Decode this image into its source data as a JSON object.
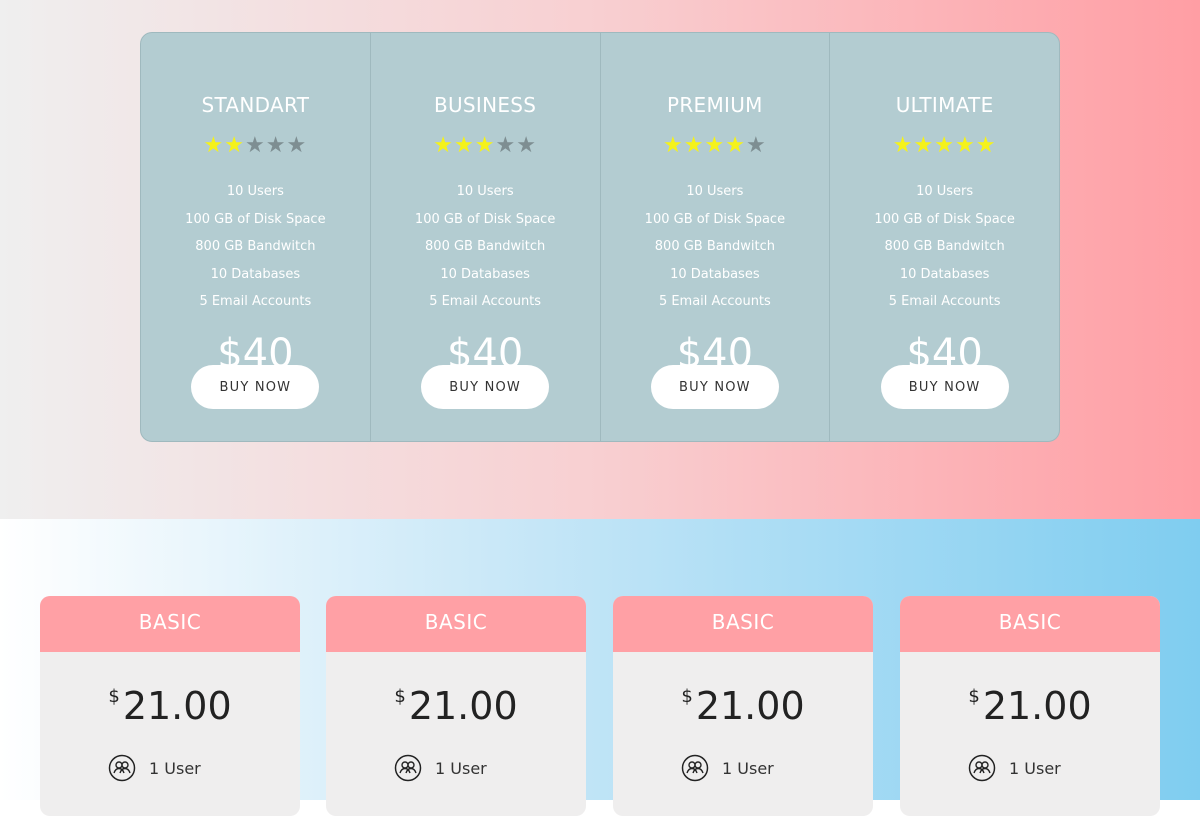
{
  "pricing_table": {
    "plans": [
      {
        "name": "STANDART",
        "rating": 2,
        "max_rating": 5,
        "features": [
          "10 Users",
          "100 GB of Disk Space",
          "800 GB Bandwitch",
          "10 Databases",
          "5 Email Accounts"
        ],
        "price": "$40",
        "button_label": "BUY NOW"
      },
      {
        "name": "BUSINESS",
        "rating": 3,
        "max_rating": 5,
        "features": [
          "10 Users",
          "100 GB of Disk Space",
          "800 GB Bandwitch",
          "10 Databases",
          "5 Email Accounts"
        ],
        "price": "$40",
        "button_label": "BUY NOW"
      },
      {
        "name": "PREMIUM",
        "rating": 4,
        "max_rating": 5,
        "features": [
          "10 Users",
          "100 GB of Disk Space",
          "800 GB Bandwitch",
          "10 Databases",
          "5 Email Accounts"
        ],
        "price": "$40",
        "button_label": "BUY NOW"
      },
      {
        "name": "ULTIMATE",
        "rating": 5,
        "max_rating": 5,
        "features": [
          "10 Users",
          "100 GB of Disk Space",
          "800 GB Bandwitch",
          "10 Databases",
          "5 Email Accounts"
        ],
        "price": "$40",
        "button_label": "BUY NOW"
      }
    ]
  },
  "cards": [
    {
      "title": "BASIC",
      "currency": "$",
      "amount": "21.00",
      "feature_icon": "users-icon",
      "feature": "1 User"
    },
    {
      "title": "BASIC",
      "currency": "$",
      "amount": "21.00",
      "feature_icon": "users-icon",
      "feature": "1 User"
    },
    {
      "title": "BASIC",
      "currency": "$",
      "amount": "21.00",
      "feature_icon": "users-icon",
      "feature": "1 User"
    },
    {
      "title": "BASIC",
      "currency": "$",
      "amount": "21.00",
      "feature_icon": "users-icon",
      "feature": "1 User"
    }
  ],
  "colors": {
    "top_gradient": [
      "#efefef",
      "#f8cfd1",
      "#ff9ea4"
    ],
    "table_bg": "#b3ccd1",
    "star_on": "#f5f21a",
    "star_off": "#7e8e92",
    "card_header": "#ffa0a5",
    "bottom_gradient": [
      "#ffffff",
      "#c5e6f7",
      "#7fcdf0"
    ]
  }
}
